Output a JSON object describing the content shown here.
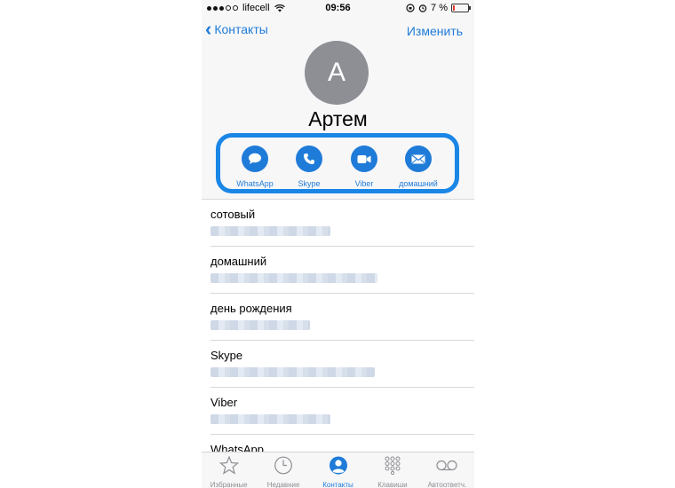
{
  "status_bar": {
    "carrier": "lifecell",
    "time": "09:56",
    "battery": "7 %"
  },
  "nav": {
    "back_label": "Контакты",
    "edit_label": "Изменить"
  },
  "contact": {
    "initial": "А",
    "name": "Артем"
  },
  "actions": [
    {
      "label": "WhatsApp",
      "icon": "message-icon"
    },
    {
      "label": "Skype",
      "icon": "phone-icon"
    },
    {
      "label": "Viber",
      "icon": "video-icon"
    },
    {
      "label": "домашний",
      "icon": "mail-icon"
    }
  ],
  "fields": [
    {
      "label": "сотовый"
    },
    {
      "label": "домашний"
    },
    {
      "label": "день рождения"
    },
    {
      "label": "Skype"
    },
    {
      "label": "Viber"
    },
    {
      "label": "WhatsApp"
    }
  ],
  "tabs": [
    {
      "label": "Избранные",
      "icon": "star-icon"
    },
    {
      "label": "Недавние",
      "icon": "clock-icon"
    },
    {
      "label": "Контакты",
      "icon": "person-icon",
      "active": true
    },
    {
      "label": "Клавиши",
      "icon": "keypad-icon"
    },
    {
      "label": "Автоответч.",
      "icon": "voicemail-icon"
    }
  ],
  "colors": {
    "accent": "#1f7bd8",
    "highlight_frame": "#1a86e6",
    "avatar": "#8e8f95"
  }
}
